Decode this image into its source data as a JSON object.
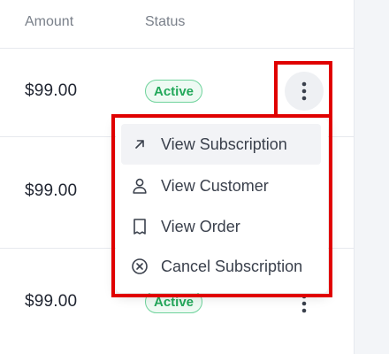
{
  "table": {
    "headers": {
      "amount": "Amount",
      "status": "Status"
    },
    "rows": [
      {
        "amount": "$99.00",
        "status": "Active"
      },
      {
        "amount": "$99.00",
        "status": ""
      },
      {
        "amount": "$99.00",
        "status": "Active"
      }
    ]
  },
  "row_actions_menu": {
    "items": [
      {
        "label": "View Subscription",
        "icon": "arrow-up-right-icon"
      },
      {
        "label": "View Customer",
        "icon": "user-icon"
      },
      {
        "label": "View Order",
        "icon": "receipt-icon"
      },
      {
        "label": "Cancel Subscription",
        "icon": "x-circle-icon"
      }
    ],
    "hovered_index": 0
  },
  "colors": {
    "status_active_text": "#22a85a",
    "status_active_border": "#6fd39c",
    "highlight": "#e00000"
  }
}
